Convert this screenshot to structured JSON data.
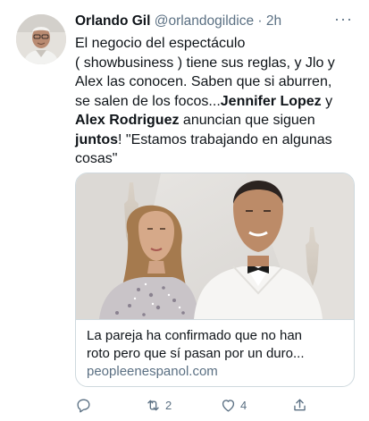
{
  "tweet": {
    "author_name": "Orlando Gil",
    "author_handle": "@orlandogildice",
    "separator": "·",
    "time": "2h",
    "more_label": "···",
    "text": {
      "l1": "El negocio del espectáculo",
      "l2": "( showbusiness ) tiene sus reglas, y Jlo y",
      "l3": "Alex las conocen. Saben que si aburren,",
      "l4a": "se salen de los focos...",
      "l4b": "Jennifer Lopez",
      "l4c": " y",
      "l5a": "Alex Rodriguez",
      "l5b": " anuncian que siguen",
      "l6a": "juntos",
      "l6b": "! \"Estamos trabajando en algunas",
      "l7": "cosas\""
    },
    "card": {
      "title_l1": "La pareja ha confirmado que no han",
      "title_l2": "roto pero que sí pasan por un duro...",
      "domain": "peopleenespanol.com"
    },
    "actions": {
      "reply_count": "",
      "retweet_count": "2",
      "like_count": "4",
      "share_count": ""
    }
  },
  "colors": {
    "text": "#0f1419",
    "secondary": "#5b7083",
    "border": "#cfd9de",
    "background": "#ffffff"
  },
  "icons": [
    "reply-icon",
    "retweet-icon",
    "heart-icon",
    "share-icon",
    "more-icon"
  ]
}
